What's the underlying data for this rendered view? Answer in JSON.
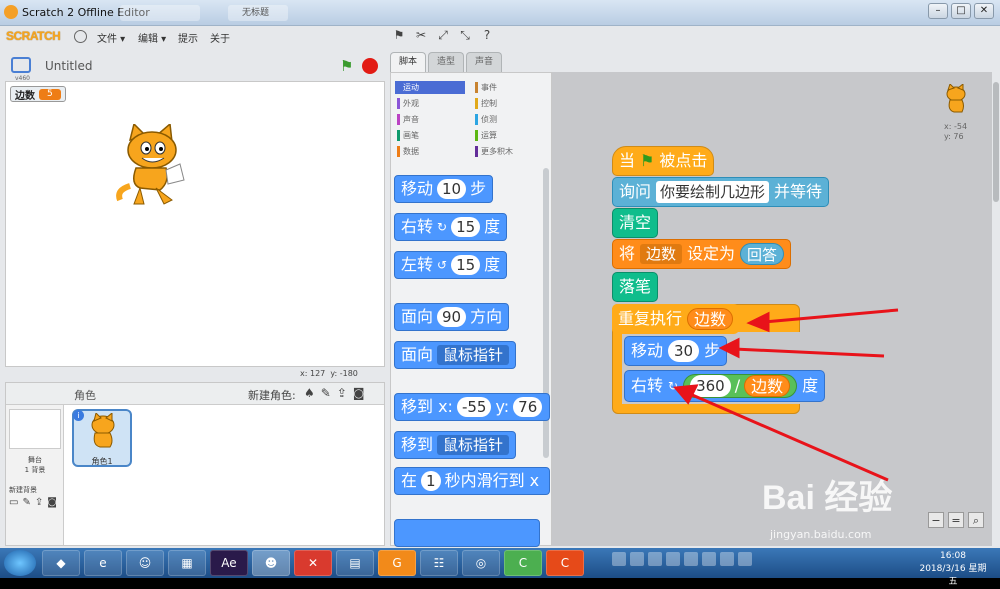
{
  "titlebar": {
    "title": "Scratch 2 Offline Editor",
    "ghost_tab": "无标题"
  },
  "menu": {
    "logo": "SCRATCH",
    "file": "文件 ▾",
    "edit": "编辑 ▾",
    "tips": "提示",
    "about": "关于"
  },
  "stage": {
    "project_name": "Untitled",
    "var_name": "边数",
    "var_value": "5",
    "version": "v460",
    "coord_x": "x: 127",
    "coord_y": "y: -180"
  },
  "sprites": {
    "title": "角色",
    "new_sprite": "新建角色:",
    "stage_label": "舞台",
    "stage_bg_count": "1 背景",
    "new_backdrop": "新建背景",
    "sprite1": "角色1"
  },
  "tabs": [
    "脚本",
    "造型",
    "声音"
  ],
  "categories": [
    {
      "label": "运动",
      "color": "#4a6cd4"
    },
    {
      "label": "事件",
      "color": "#c88330"
    },
    {
      "label": "外观",
      "color": "#8a55d7"
    },
    {
      "label": "控制",
      "color": "#e1a91a"
    },
    {
      "label": "声音",
      "color": "#bb42c3"
    },
    {
      "label": "侦测",
      "color": "#2ca5e2"
    },
    {
      "label": "画笔",
      "color": "#0e9a6c"
    },
    {
      "label": "运算",
      "color": "#5cb712"
    },
    {
      "label": "数据",
      "color": "#ee7d16"
    },
    {
      "label": "更多积木",
      "color": "#632d99"
    }
  ],
  "palette": {
    "move": "移动",
    "move_val": "10",
    "steps": "步",
    "turn_right": "右转",
    "turn_right_val": "15",
    "degrees": "度",
    "turn_left": "左转",
    "turn_left_val": "15",
    "point_dir": "面向",
    "point_dir_val": "90",
    "direction": "方向",
    "point_towards": "面向",
    "mouse_pointer": "鼠标指针",
    "goto_xy": "移到 x:",
    "goto_x": "-55",
    "goto_y_label": "y:",
    "goto_y": "76",
    "goto": "移到",
    "goto_target": "鼠标指针",
    "glide_pre": "在",
    "glide_val": "1",
    "glide_post": "秒内滑行到 x"
  },
  "script": {
    "when_flag": "当",
    "clicked": "被点击",
    "ask": "询问",
    "ask_text": "你要绘制几边形",
    "and_wait": "并等待",
    "clear": "清空",
    "set": "将",
    "set_var": "边数",
    "set_to": "设定为",
    "answer": "回答",
    "pen_down": "落笔",
    "repeat": "重复执行",
    "repeat_var": "边数",
    "move": "移动",
    "move_val": "30",
    "steps": "步",
    "turn": "右转",
    "turn_val": "360",
    "div": "/",
    "div_var": "边数",
    "degrees": "度",
    "sprite_x": "x: -54",
    "sprite_y": "y: 76"
  },
  "watermark": {
    "main": "Bai 经验",
    "url": "jingyan.baidu.com"
  },
  "taskbar": {
    "time": "16:08",
    "date": "2018/3/16 星期五"
  },
  "colors": {
    "motion": "#4c97ff",
    "events": "#ffab19",
    "sensing": "#5cb1d6",
    "pen": "#0fbd8c",
    "variables": "#ff8c1a",
    "operators": "#59c059",
    "arrow": "#e8131a"
  }
}
